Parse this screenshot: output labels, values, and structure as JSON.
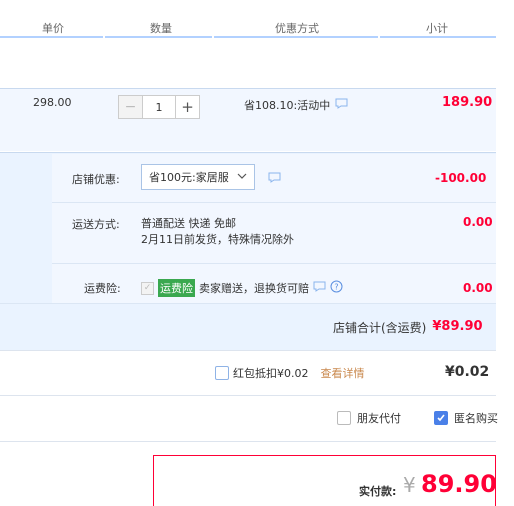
{
  "header": {
    "col_price": "单价",
    "col_qty": "数量",
    "col_promo": "优惠方式",
    "col_subtotal": "小计"
  },
  "item": {
    "unit_price": "298.00",
    "quantity": "1",
    "minus": "−",
    "plus": "+",
    "promo": "省108.10:活动中",
    "subtotal": "189.90"
  },
  "shop": {
    "discount_label": "店铺优惠:",
    "discount_option": "省100元:家居服",
    "discount_amount": "-100.00",
    "shipping_label": "运送方式:",
    "shipping_line1": "普通配送 快递 免邮",
    "shipping_line2": "2月11日前发货，特殊情况除外",
    "shipping_amount": "0.00",
    "insurance_label": "运费险:",
    "insurance_tag": "运费险",
    "insurance_desc": "卖家赠送，退换货可赔",
    "insurance_amount": "0.00",
    "total_label": "店铺合计(含运费)",
    "total_value": "¥89.90"
  },
  "redpacket": {
    "label": "红包抵扣¥0.02",
    "detail_link": "查看详情",
    "amount": "¥0.02"
  },
  "options": {
    "friend_pay": "朋友代付",
    "anonymous": "匿名购买"
  },
  "payment": {
    "label": "实付款:",
    "currency": "¥",
    "value": "89.90"
  },
  "colors": {
    "accent_red": "#ff0036",
    "header_border": "#b2d1ff",
    "row_bg": "#f2f7ff",
    "shop_bg": "#eaf3ff"
  }
}
